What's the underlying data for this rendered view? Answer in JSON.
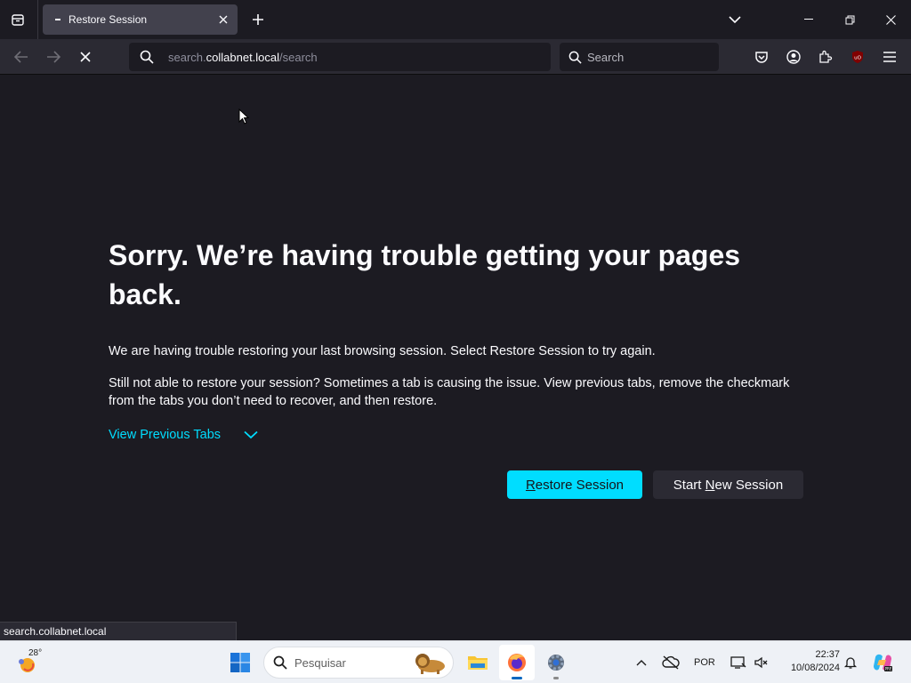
{
  "browser": {
    "tab": {
      "title": "Restore Session"
    },
    "url": {
      "prefix": "search.",
      "host": "collabnet.local",
      "path": "/search"
    },
    "search_placeholder": "Search",
    "status_tip": "search.collabnet.local"
  },
  "page": {
    "heading": "Sorry. We’re having trouble getting your pages back.",
    "paragraph1": "We are having trouble restoring your last browsing session. Select Restore Session to try again.",
    "paragraph2": "Still not able to restore your session? Sometimes a tab is causing the issue. View previous tabs, remove the checkmark from the tabs you don’t need to recover, and then restore.",
    "view_previous_tabs": "View Previous Tabs",
    "restore_button": {
      "accesskey": "R",
      "rest": "estore Session"
    },
    "new_session_button": {
      "before": "Start ",
      "accesskey": "N",
      "rest": "ew Session"
    }
  },
  "taskbar": {
    "weather_temp": "28°",
    "search_placeholder": "Pesquisar",
    "language": "POR",
    "time": "22:37",
    "date": "10/08/2024"
  },
  "colors": {
    "accent": "#00ddff",
    "page_bg": "#1c1b22",
    "toolbar_bg": "#2b2a33"
  }
}
